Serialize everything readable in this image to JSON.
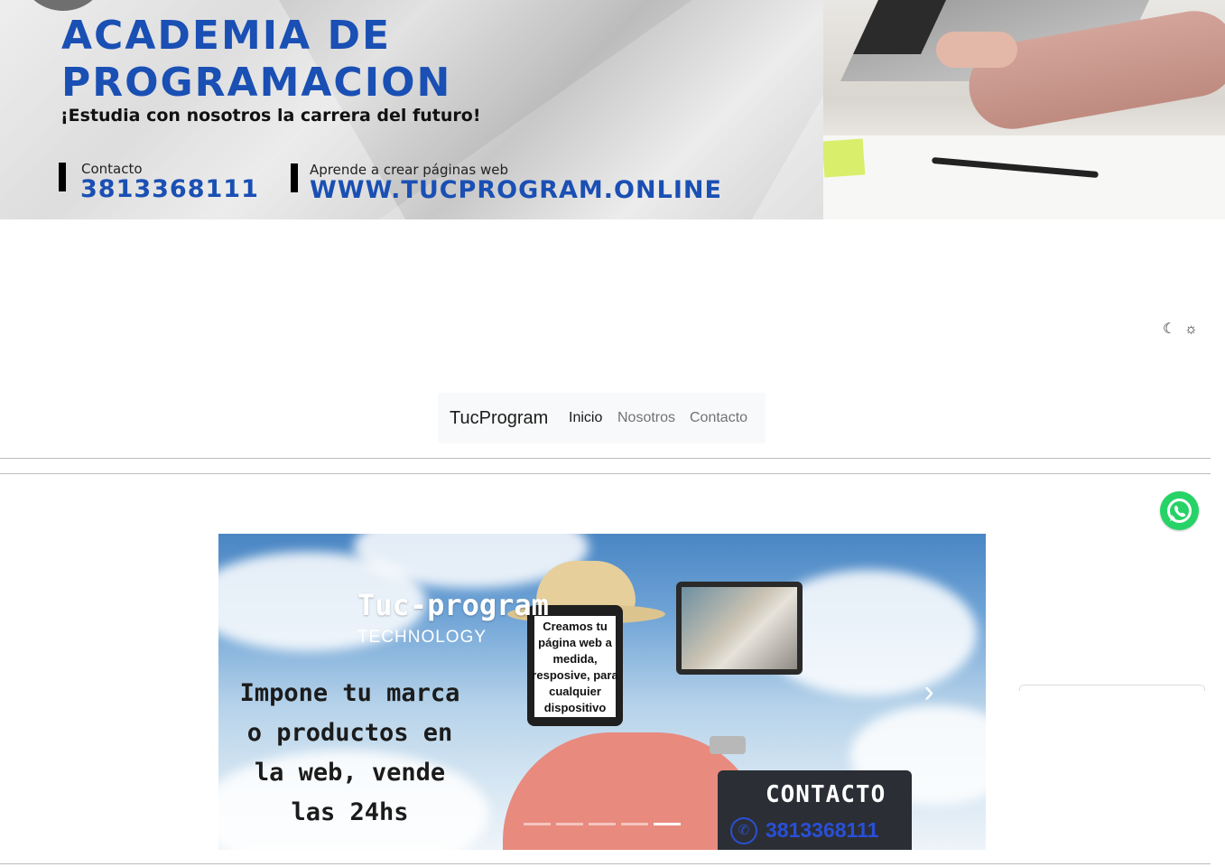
{
  "banner": {
    "title_line1": "ACADEMIA DE",
    "title_line2": "PROGRAMACION",
    "subtitle": "¡Estudia con nosotros la carrera del futuro!",
    "contact_label": "Contacto",
    "contact_phone": "3813368111",
    "web_label": "Aprende a crear páginas web",
    "web_url": "WWW.TUCPROGRAM.ONLINE"
  },
  "theme": {
    "dark_icon": "moon-icon",
    "light_icon": "sun-icon",
    "dark_glyph": "☾",
    "light_glyph": "☼"
  },
  "navbar": {
    "brand": "TucProgram",
    "items": [
      {
        "label": "Inicio",
        "active": true
      },
      {
        "label": "Nosotros",
        "active": false
      },
      {
        "label": "Contacto",
        "active": false
      }
    ]
  },
  "whatsapp": {
    "icon": "whatsapp-icon",
    "color": "#25d366"
  },
  "carousel": {
    "title": "Tuc-program",
    "subtitle": "TECHNOLOGY",
    "tablet_text": "Creamos tu página web a medida, resposive, para cualquier dispositivo",
    "slogan": "Impone tu marca o productos en la web, vende las 24hs",
    "contact_title": "CONTACTO",
    "contact_phone": "3813368111",
    "next_glyph": "›",
    "prev_glyph": "‹",
    "slide_count": 5,
    "active_slide": 5
  },
  "colors": {
    "brand_blue": "#1a4fb4",
    "phone_blue": "#2a4fd6",
    "navbar_bg": "#f8f9fa"
  }
}
